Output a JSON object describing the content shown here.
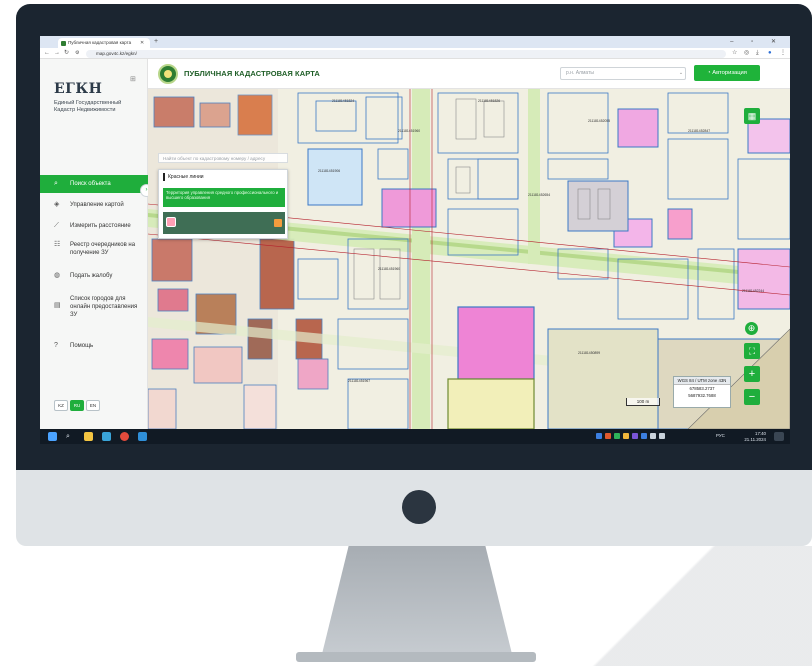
{
  "browser": {
    "tab_title": "Публичная кадастровая карта",
    "tab_close": "✕",
    "tab_new": "+",
    "window_controls": "– ▫ ✕",
    "url": "map.gov4c.kz/egkn/",
    "nav_back": "←",
    "nav_forward": "→",
    "nav_reload": "↻",
    "nav_site_info": "⚙",
    "icons": [
      "star-icon",
      "extensions-icon",
      "download-icon",
      "profile-icon",
      "menu-icon"
    ]
  },
  "sidebar": {
    "brand": "ЕГКН",
    "brand_subtitle": "Единый Государственный Кадастр Недвижимости",
    "items": [
      {
        "label": "Поиск объекта",
        "icon": "search-icon",
        "active": true
      },
      {
        "label": "Управление картой",
        "icon": "layers-icon",
        "active": false
      },
      {
        "label": "Измерить расстояние",
        "icon": "ruler-icon",
        "active": false
      },
      {
        "label": "Реестр очередников на получение ЗУ",
        "icon": "registry-icon",
        "active": false
      },
      {
        "label": "Подать жалобу",
        "icon": "complaint-icon",
        "active": false
      },
      {
        "label": "Список городов для онлайн предоставления ЗУ",
        "icon": "list-icon",
        "active": false
      },
      {
        "label": "Помощь",
        "icon": "help-icon",
        "active": false
      }
    ],
    "languages": [
      {
        "code": "KZ",
        "active": false
      },
      {
        "code": "RU",
        "active": true
      },
      {
        "code": "EN",
        "active": false
      }
    ]
  },
  "header": {
    "title": "ПУБЛИЧНАЯ КАДАСТРОВАЯ КАРТА",
    "search_placeholder": "р.н. Алматы",
    "auth_label": "Авторизация"
  },
  "layer_panel": {
    "search_placeholder": "Найти объект по кадастровому номеру / адресу",
    "title": "Красные линии",
    "item_text": "Территория управления средного профессионального и высшего образования"
  },
  "map": {
    "scale_label": "100 m",
    "coords": {
      "header": "WGS 84 / UTM zone 43N",
      "x": "678583.2737",
      "y": "5687932.7688"
    }
  },
  "taskbar": {
    "time": "17:40",
    "date": "21.11.2024",
    "lang": "РУС"
  },
  "colors": {
    "accent": "#1fae3c",
    "brand_dark": "#2c3a48"
  }
}
